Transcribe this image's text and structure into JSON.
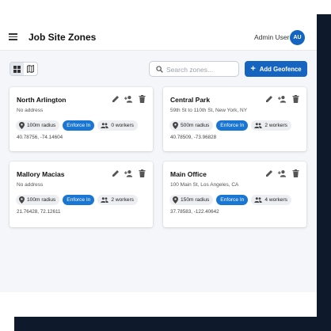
{
  "header": {
    "title": "Job Site Zones",
    "user_name": "Admin User",
    "avatar_initials": "AU"
  },
  "toolbar": {
    "search_placeholder": "Search zones...",
    "search_value": "",
    "add_label": "Add Geofence",
    "view_mode": "grid"
  },
  "zones": [
    {
      "name": "North Arlington",
      "address": "No address",
      "radius": "100m radius",
      "enforce": "Enforce In",
      "workers": "0 workers",
      "coords": "40.78756, -74.14604"
    },
    {
      "name": "Central Park",
      "address": "59th St to 110th St, New York, NY",
      "radius": "500m radius",
      "enforce": "Enforce In",
      "workers": "2 workers",
      "coords": "40.78509, -73.96828"
    },
    {
      "name": "Mallory Macias",
      "address": "No address",
      "radius": "100m radius",
      "enforce": "Enforce In",
      "workers": "2 workers",
      "coords": "21.76428, 72.12611"
    },
    {
      "name": "Main Office",
      "address": "100 Main St, Los Angeles, CA",
      "radius": "150m radius",
      "enforce": "Enforce In",
      "workers": "4 workers",
      "coords": "37.78583, -122.40642"
    }
  ],
  "colors": {
    "primary": "#1565c0",
    "enforce_chip": "#1976d2",
    "backdrop": "#0e1a2b",
    "page_bg": "#f4f6f9"
  },
  "icons": {
    "menu": "hamburger-icon",
    "grid_view": "grid-icon",
    "map_view": "map-icon",
    "search": "search-icon",
    "add": "plus-icon",
    "edit": "pencil-icon",
    "assign": "person-add-icon",
    "delete": "trash-icon",
    "radius": "location-pin-icon",
    "workers": "people-icon"
  }
}
